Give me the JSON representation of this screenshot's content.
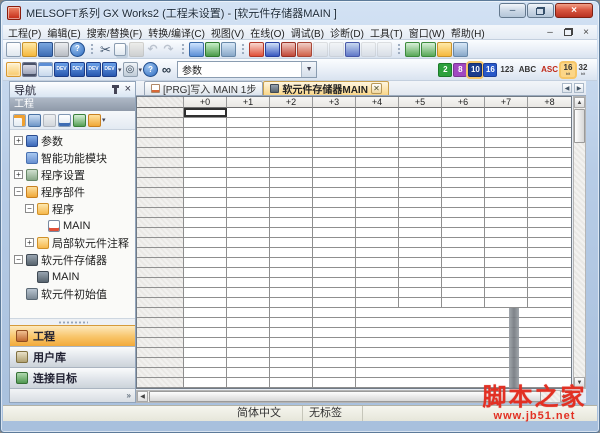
{
  "window": {
    "title": "MELSOFT系列 GX Works2 (工程未设置) - [软元件存储器MAIN ]"
  },
  "icons": {
    "up": "▲",
    "down": "▼",
    "left": "◀",
    "right": "▶",
    "close": "×",
    "min": "–",
    "chevron_right": "»",
    "tab_scroll_left": "◀",
    "tab_scroll_right": "▶"
  },
  "colors": {
    "accent_orange": "#f6b33c",
    "titlebar_blue": "#b7cce6",
    "active_tab": "#f9d689",
    "watermark_red": "#e23023",
    "grid_line": "#8f8f8f"
  },
  "menubar": {
    "items": [
      "工程(P)",
      "编辑(E)",
      "搜索/替换(F)",
      "转换/编译(C)",
      "视图(V)",
      "在线(O)",
      "调试(B)",
      "诊断(D)",
      "工具(T)",
      "窗口(W)",
      "帮助(H)"
    ]
  },
  "toolbarA": [
    {
      "name": "new-project-icon",
      "cls": "i-new"
    },
    {
      "name": "open-project-icon",
      "cls": "i-open"
    },
    {
      "name": "save-project-icon",
      "cls": "i-save"
    },
    {
      "name": "print-icon",
      "cls": "i-print"
    },
    {
      "name": "help-icon",
      "cls": "i-help",
      "glyph": "?"
    },
    {
      "sep": true
    },
    {
      "name": "cut-icon",
      "cls": "i-cut",
      "glyph": "✂"
    },
    {
      "name": "copy-icon",
      "cls": "i-copy"
    },
    {
      "name": "paste-icon",
      "cls": "i-paste",
      "disabled": true
    },
    {
      "name": "undo-icon",
      "cls": "i-undo",
      "glyph": "↶",
      "disabled": true
    },
    {
      "name": "redo-icon",
      "cls": "i-redo",
      "glyph": "↷",
      "disabled": true
    },
    {
      "sep": true
    },
    {
      "name": "convert-icon",
      "cls": "i-mon1"
    },
    {
      "name": "convert-all-icon",
      "cls": "i-mon2"
    },
    {
      "name": "convert-check-icon",
      "cls": "i-mon3"
    },
    {
      "sep": true
    },
    {
      "name": "write-to-plc-icon",
      "cls": "i-wr"
    },
    {
      "name": "read-from-plc-icon",
      "cls": "i-rd"
    },
    {
      "name": "monitor-mode-icon",
      "cls": "i-monr"
    },
    {
      "name": "monitor-write-icon",
      "cls": "i-monr2"
    },
    {
      "name": "monitor-stop-icon",
      "cls": "i-grayic",
      "disabled": true
    },
    {
      "name": "monitor-pause-icon",
      "cls": "i-grayic",
      "disabled": true
    },
    {
      "name": "device-test-icon",
      "cls": "i-devt"
    },
    {
      "name": "step-run-icon",
      "cls": "i-grayic",
      "disabled": true
    },
    {
      "name": "skip-run-icon",
      "cls": "i-grayic",
      "disabled": true
    },
    {
      "sep": true
    },
    {
      "name": "ladder-edit-1-icon",
      "cls": "i-lad"
    },
    {
      "name": "ladder-edit-2-icon",
      "cls": "i-lad"
    },
    {
      "name": "ladder-edit-3-icon",
      "cls": "i-open"
    },
    {
      "name": "ladder-edit-4-icon",
      "cls": "i-mon3"
    }
  ],
  "toolbarB": {
    "icons": [
      {
        "name": "navigation-window-toggle-icon",
        "cls": "i-navtog",
        "active": true
      },
      {
        "name": "function-block-list-icon",
        "cls": "i-film"
      },
      {
        "name": "output-window-icon",
        "cls": "i-winpane"
      },
      {
        "name": "device-comment-icon",
        "cls": "i-dev",
        "glyph": "DEV"
      },
      {
        "name": "device-memory-icon",
        "cls": "i-dev",
        "glyph": "DEV"
      },
      {
        "name": "device-init-icon",
        "cls": "i-dev",
        "glyph": "DEV"
      },
      {
        "name": "device-display-icon",
        "cls": "i-dev",
        "glyph": "DEV",
        "drop": true
      },
      {
        "name": "find-device-icon",
        "cls": "i-finddev",
        "glyph": "◎",
        "drop": true
      },
      {
        "name": "help-circle-icon",
        "cls": "i-help2",
        "glyph": "?"
      },
      {
        "name": "find-icon",
        "cls": "i-binoc",
        "glyph": "∞"
      }
    ],
    "combo": {
      "value": "参数"
    },
    "formats": [
      {
        "name": "format-binary-button",
        "label": "2",
        "cls": "f-green"
      },
      {
        "name": "format-octal-button",
        "label": "8",
        "cls": "f-purple"
      },
      {
        "name": "format-decimal-button",
        "label": "10",
        "cls": "f-navy",
        "selected": true
      },
      {
        "name": "format-hex-button",
        "label": "16",
        "cls": "f-blue"
      },
      {
        "name": "format-123-button",
        "label": "123",
        "cls": "f-plain"
      },
      {
        "name": "format-abc-button",
        "label": "ABC",
        "cls": "f-plain"
      },
      {
        "name": "format-ascii-button",
        "label": "ASC",
        "cls": "f-red"
      },
      {
        "name": "format-16bit-button",
        "label": "16",
        "cls": "f-plain",
        "selected": true,
        "sub": "bit"
      },
      {
        "name": "format-32bit-button",
        "label": "32",
        "cls": "f-plain",
        "sub": "bit"
      }
    ]
  },
  "nav": {
    "title": "导航",
    "section": "工程",
    "tools": [
      {
        "name": "nav-new-item-icon",
        "cls": "n-new"
      },
      {
        "name": "nav-sort-icon",
        "cls": "n-sort"
      },
      {
        "name": "nav-edit-icon",
        "cls": "n-gray"
      },
      {
        "name": "nav-info-icon",
        "cls": "n-info"
      },
      {
        "name": "nav-list-icon",
        "cls": "n-xls"
      },
      {
        "name": "nav-filter-icon",
        "cls": "n-filter",
        "drop": true
      }
    ],
    "tree": [
      {
        "label": "参数",
        "expand": "+",
        "depth": 0,
        "icon": "t-param"
      },
      {
        "label": "智能功能模块",
        "expand": "",
        "depth": 0,
        "icon": "t-module"
      },
      {
        "label": "程序设置",
        "expand": "+",
        "depth": 0,
        "icon": "t-settings"
      },
      {
        "label": "程序部件",
        "expand": "−",
        "depth": 0,
        "icon": "t-pou"
      },
      {
        "label": "程序",
        "expand": "−",
        "depth": 1,
        "icon": "t-folder"
      },
      {
        "label": "MAIN",
        "expand": "",
        "depth": 2,
        "icon": "t-doc"
      },
      {
        "label": "局部软元件注释",
        "expand": "+",
        "depth": 1,
        "icon": "t-folder"
      },
      {
        "label": "软元件存储器",
        "expand": "−",
        "depth": 0,
        "icon": "t-dev"
      },
      {
        "label": "MAIN",
        "expand": "",
        "depth": 1,
        "icon": "t-dev"
      },
      {
        "label": "软元件初始值",
        "expand": "",
        "depth": 0,
        "icon": "t-devinit"
      }
    ],
    "buttons": [
      {
        "label": "工程",
        "icon": "nbi-project",
        "active": true
      },
      {
        "label": "用户库",
        "icon": "nbi-userlib"
      },
      {
        "label": "连接目标",
        "icon": "nbi-connect"
      }
    ]
  },
  "tabs": [
    {
      "label": "[PRG]写入 MAIN 1步",
      "icon": "tabico-prg",
      "active": false
    },
    {
      "label": "软元件存储器MAIN",
      "icon": "tabico-dev",
      "active": true,
      "closable": true
    }
  ],
  "grid": {
    "columns": [
      "+0",
      "+1",
      "+2",
      "+3",
      "+4",
      "+5",
      "+6",
      "+7",
      "+8"
    ],
    "upper_rows": 20,
    "lower_rows": 8,
    "selected_cell": {
      "row": 0,
      "col": 0
    }
  },
  "statusbar": {
    "language": "简体中文",
    "label": "无标签"
  },
  "watermark": {
    "line1": "脚本之家",
    "line2": "www.jb51.net"
  }
}
